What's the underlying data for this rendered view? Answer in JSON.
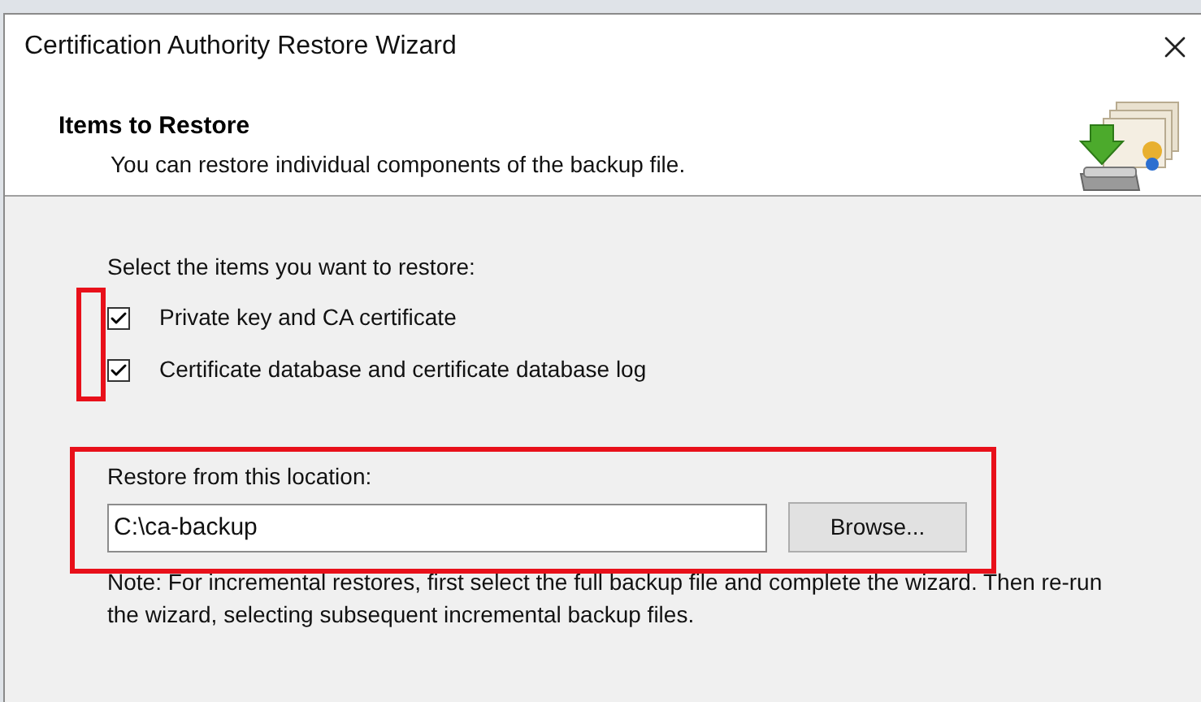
{
  "window": {
    "title": "Certification Authority Restore Wizard"
  },
  "header": {
    "title": "Items to Restore",
    "subtitle": "You can restore individual components of the backup file."
  },
  "items_prompt": "Select the items you want to restore:",
  "items": [
    {
      "label": "Private key and CA certificate",
      "checked": true
    },
    {
      "label": "Certificate database and certificate database log",
      "checked": true
    }
  ],
  "location": {
    "label": "Restore from this location:",
    "value": "C:\\ca-backup",
    "browse_button": "Browse..."
  },
  "note": "Note: For incremental restores, first select the full backup file and complete the wizard. Then re-run the wizard, selecting subsequent incremental backup files."
}
